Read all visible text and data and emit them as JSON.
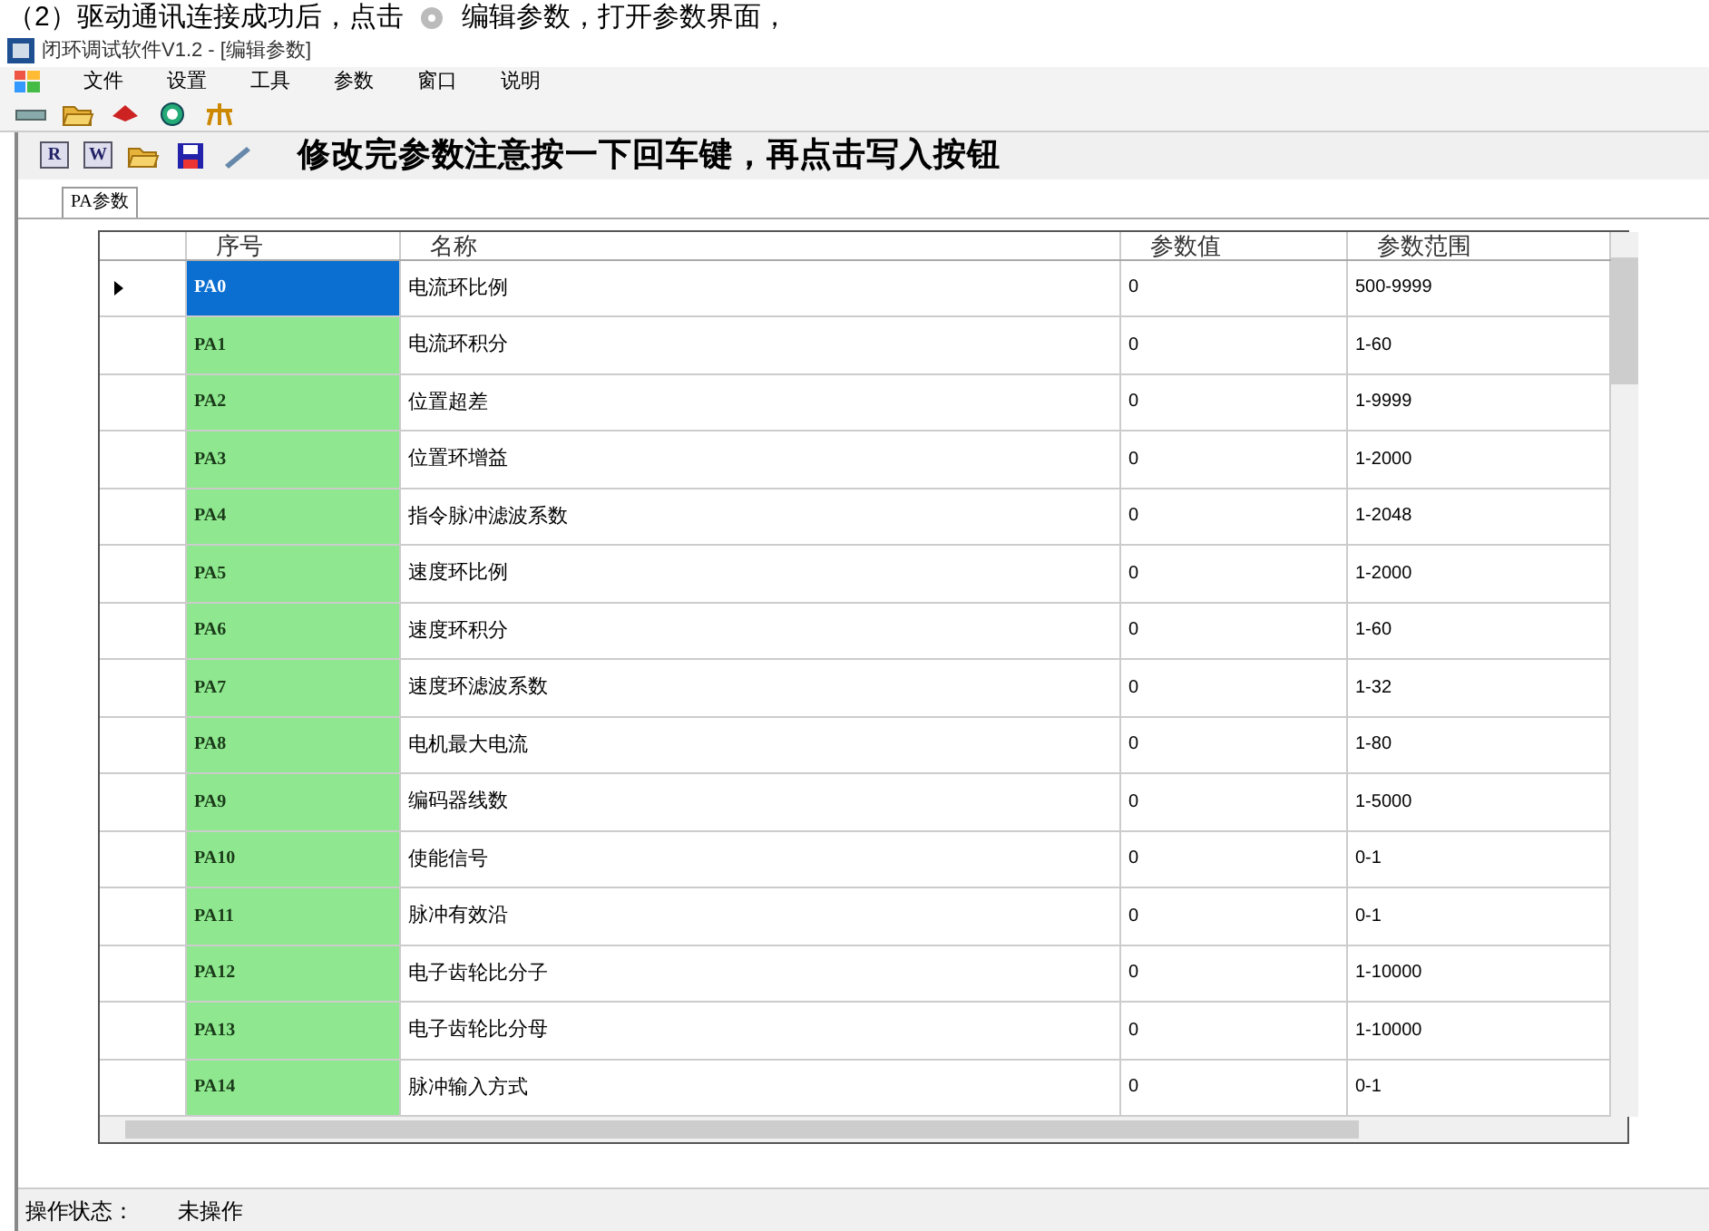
{
  "instruction": {
    "before": "（2）驱动通讯连接成功后，点击",
    "after": "编辑参数，打开参数界面，"
  },
  "window": {
    "title": "闭环调试软件V1.2 - [编辑参数]"
  },
  "menu": [
    "文件",
    "设置",
    "工具",
    "参数",
    "窗口",
    "说明"
  ],
  "toolbar2": {
    "read_label": "R",
    "write_label": "W",
    "notice": "修改完参数注意按一下回车键，再点击写入按钮"
  },
  "tabs": [
    {
      "label": "PA参数",
      "selected": true
    }
  ],
  "table": {
    "columns": [
      "序号",
      "名称",
      "参数值",
      "参数范围"
    ],
    "rows": [
      {
        "id": "PA0",
        "name": "电流环比例",
        "value": "0",
        "range": "500-9999",
        "selected": true
      },
      {
        "id": "PA1",
        "name": "电流环积分",
        "value": "0",
        "range": "1-60",
        "selected": false
      },
      {
        "id": "PA2",
        "name": "位置超差",
        "value": "0",
        "range": "1-9999",
        "selected": false
      },
      {
        "id": "PA3",
        "name": "位置环增益",
        "value": "0",
        "range": "1-2000",
        "selected": false
      },
      {
        "id": "PA4",
        "name": "指令脉冲滤波系数",
        "value": "0",
        "range": "1-2048",
        "selected": false
      },
      {
        "id": "PA5",
        "name": "速度环比例",
        "value": "0",
        "range": "1-2000",
        "selected": false
      },
      {
        "id": "PA6",
        "name": "速度环积分",
        "value": "0",
        "range": "1-60",
        "selected": false
      },
      {
        "id": "PA7",
        "name": "速度环滤波系数",
        "value": "0",
        "range": "1-32",
        "selected": false
      },
      {
        "id": "PA8",
        "name": "电机最大电流",
        "value": "0",
        "range": "1-80",
        "selected": false
      },
      {
        "id": "PA9",
        "name": "编码器线数",
        "value": "0",
        "range": "1-5000",
        "selected": false
      },
      {
        "id": "PA10",
        "name": "使能信号",
        "value": "0",
        "range": "0-1",
        "selected": false
      },
      {
        "id": "PA11",
        "name": "脉冲有效沿",
        "value": "0",
        "range": "0-1",
        "selected": false
      },
      {
        "id": "PA12",
        "name": "电子齿轮比分子",
        "value": "0",
        "range": "1-10000",
        "selected": false
      },
      {
        "id": "PA13",
        "name": "电子齿轮比分母",
        "value": "0",
        "range": "1-10000",
        "selected": false
      },
      {
        "id": "PA14",
        "name": "脉冲输入方式",
        "value": "0",
        "range": "0-1",
        "selected": false
      }
    ]
  },
  "status_bar": {
    "label": "操作状态：",
    "value": "未操作"
  }
}
